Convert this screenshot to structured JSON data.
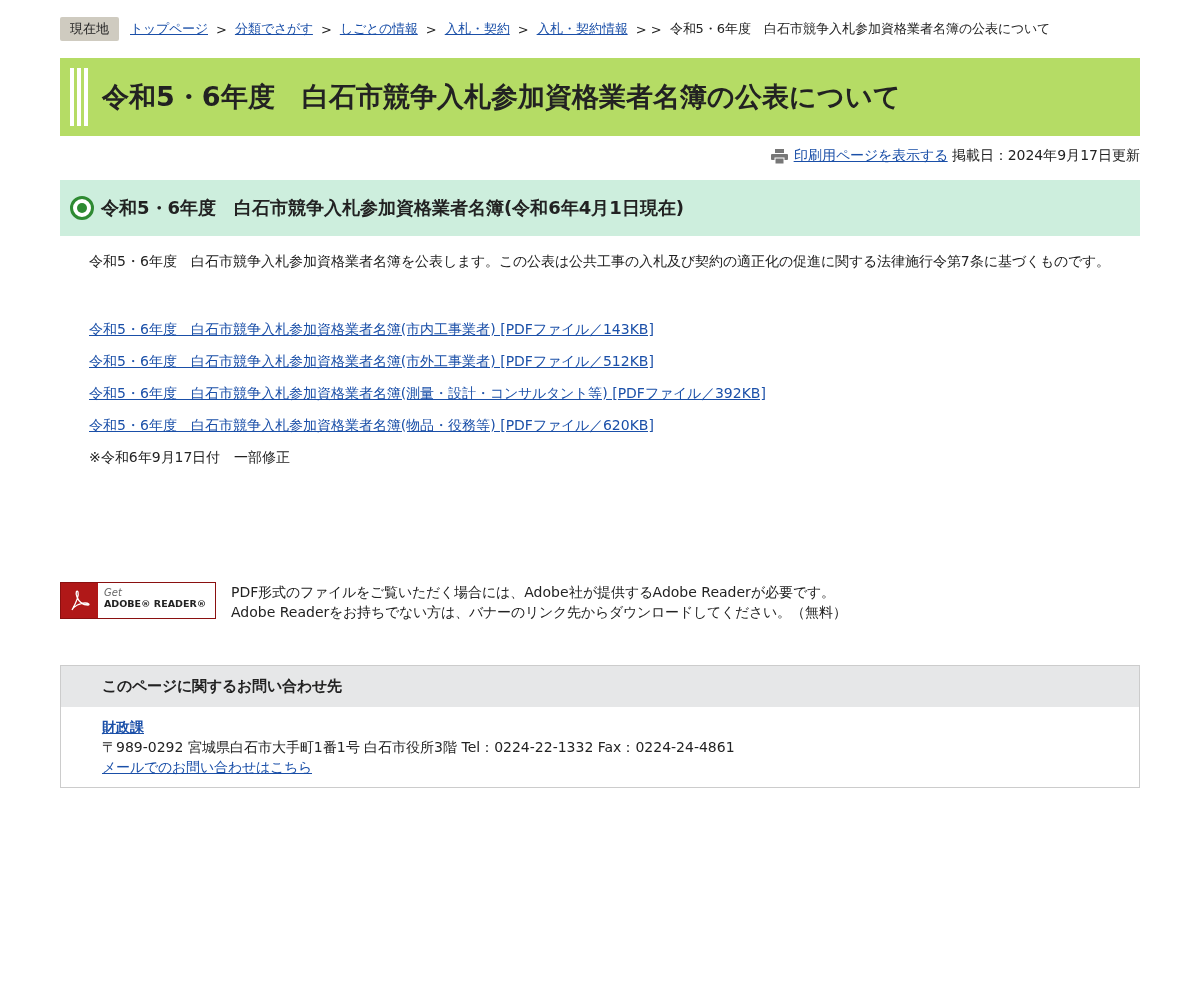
{
  "breadcrumb": {
    "label": "現在地",
    "items": [
      {
        "kind": "link",
        "text": "トップページ"
      },
      {
        "kind": "separator",
        "text": ">"
      },
      {
        "kind": "link",
        "text": "分類でさがす"
      },
      {
        "kind": "separator",
        "text": ">"
      },
      {
        "kind": "link",
        "text": "しごとの情報"
      },
      {
        "kind": "separator",
        "text": ">"
      },
      {
        "kind": "link",
        "text": "入札・契約"
      },
      {
        "kind": "separator",
        "text": ">"
      },
      {
        "kind": "link",
        "text": "入札・契約情報"
      },
      {
        "kind": "separator",
        "text": "> >"
      },
      {
        "kind": "current",
        "text": "令和5・6年度　白石市競争入札参加資格業者名簿の公表について"
      }
    ]
  },
  "page_title": "令和5・6年度　白石市競争入札参加資格業者名簿の公表について",
  "meta": {
    "print_link": "印刷用ページを表示する",
    "date": "掲載日：2024年9月17日更新"
  },
  "section": {
    "heading": "令和5・6年度　白石市競争入札参加資格業者名簿(令和6年4月1日現在)",
    "intro": "令和5・6年度　白石市競争入札参加資格業者名簿を公表します。この公表は公共工事の入札及び契約の適正化の促進に関する法律施行令第7条に基づくものです。",
    "links": [
      "令和5・6年度　白石市競争入札参加資格業者名簿(市内工事業者) [PDFファイル／143KB]",
      "令和5・6年度　白石市競争入札参加資格業者名簿(市外工事業者) [PDFファイル／512KB]",
      "令和5・6年度　白石市競争入札参加資格業者名簿(測量・設計・コンサルタント等) [PDFファイル／392KB]",
      "令和5・6年度　白石市競争入札参加資格業者名簿(物品・役務等) [PDFファイル／620KB]"
    ],
    "note": "※令和6年9月17日付　一部修正"
  },
  "adobe": {
    "banner_get": "Get",
    "banner_name": "ADOBE® READER®",
    "lines": [
      "PDF形式のファイルをご覧いただく場合には、Adobe社が提供するAdobe Readerが必要です。",
      "Adobe Readerをお持ちでない方は、バナーのリンク先からダウンロードしてください。（無料）"
    ]
  },
  "contact": {
    "heading": "このページに関するお問い合わせ先",
    "department": "財政課",
    "address": "〒989-0292 宮城県白石市大手町1番1号 白石市役所3階 Tel：0224-22-1332 Fax：0224-24-4861",
    "mail_link": "メールでのお問い合わせはこちら"
  }
}
